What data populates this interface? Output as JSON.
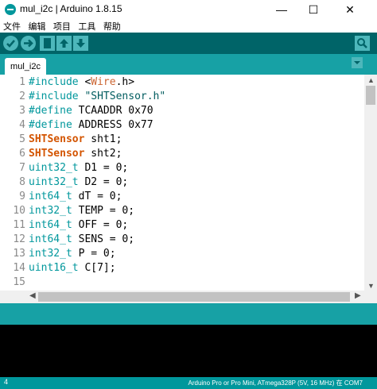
{
  "window": {
    "title": "mul_i2c | Arduino 1.8.15",
    "minimize": "—",
    "maximize": "☐",
    "close": "✕"
  },
  "menu": [
    "文件",
    "编辑",
    "项目",
    "工具",
    "帮助"
  ],
  "toolbar": {
    "buttons": [
      "verify-icon",
      "upload-icon",
      "new-icon",
      "open-icon",
      "save-icon"
    ],
    "serial_monitor": "serial-monitor-icon"
  },
  "tabs": [
    {
      "label": "mul_i2c"
    }
  ],
  "code_lines": [
    {
      "n": "1"
    },
    {
      "n": "2"
    },
    {
      "n": "3"
    },
    {
      "n": "4"
    },
    {
      "n": "5"
    },
    {
      "n": "6"
    },
    {
      "n": "7"
    },
    {
      "n": "8"
    },
    {
      "n": "9"
    },
    {
      "n": "10"
    },
    {
      "n": "11"
    },
    {
      "n": "12"
    },
    {
      "n": "13"
    },
    {
      "n": "14"
    },
    {
      "n": "15"
    }
  ],
  "code": {
    "l1": [
      "#include",
      " <",
      "Wire",
      ".h>"
    ],
    "l2": [
      "#include",
      " \"",
      "SHTSensor",
      ".h\""
    ],
    "l3": [
      "#define",
      " TCAADDR 0x70"
    ],
    "l4": [
      "#define",
      " ADDRESS 0x77"
    ],
    "l5": [
      "SHTSensor",
      " sht1;"
    ],
    "l6": [
      "SHTSensor",
      " sht2;"
    ],
    "l7": [
      "uint32_t",
      " D1 = 0;"
    ],
    "l8": [
      "uint32_t",
      " D2 = 0;"
    ],
    "l9": [
      "int64_t",
      " dT = 0;"
    ],
    "l10": [
      "int32_t",
      " TEMP = 0;"
    ],
    "l11": [
      "int64_t",
      " OFF = 0;"
    ],
    "l12": [
      "int64_t",
      " SENS = 0;"
    ],
    "l13": [
      "int32_t",
      " P = 0;"
    ],
    "l14": [
      "uint16_t",
      " C[7];"
    ],
    "l15": [
      ""
    ]
  },
  "status": {
    "line": "4",
    "board": "Arduino Pro or Pro Mini, ATmega328P (5V, 16 MHz) 在 COM7"
  },
  "colors": {
    "toolbar": "#006468",
    "tabbar": "#17a1a5",
    "statusbar": "#00979c",
    "keyword": "#00979c",
    "type": "#cc6633"
  }
}
